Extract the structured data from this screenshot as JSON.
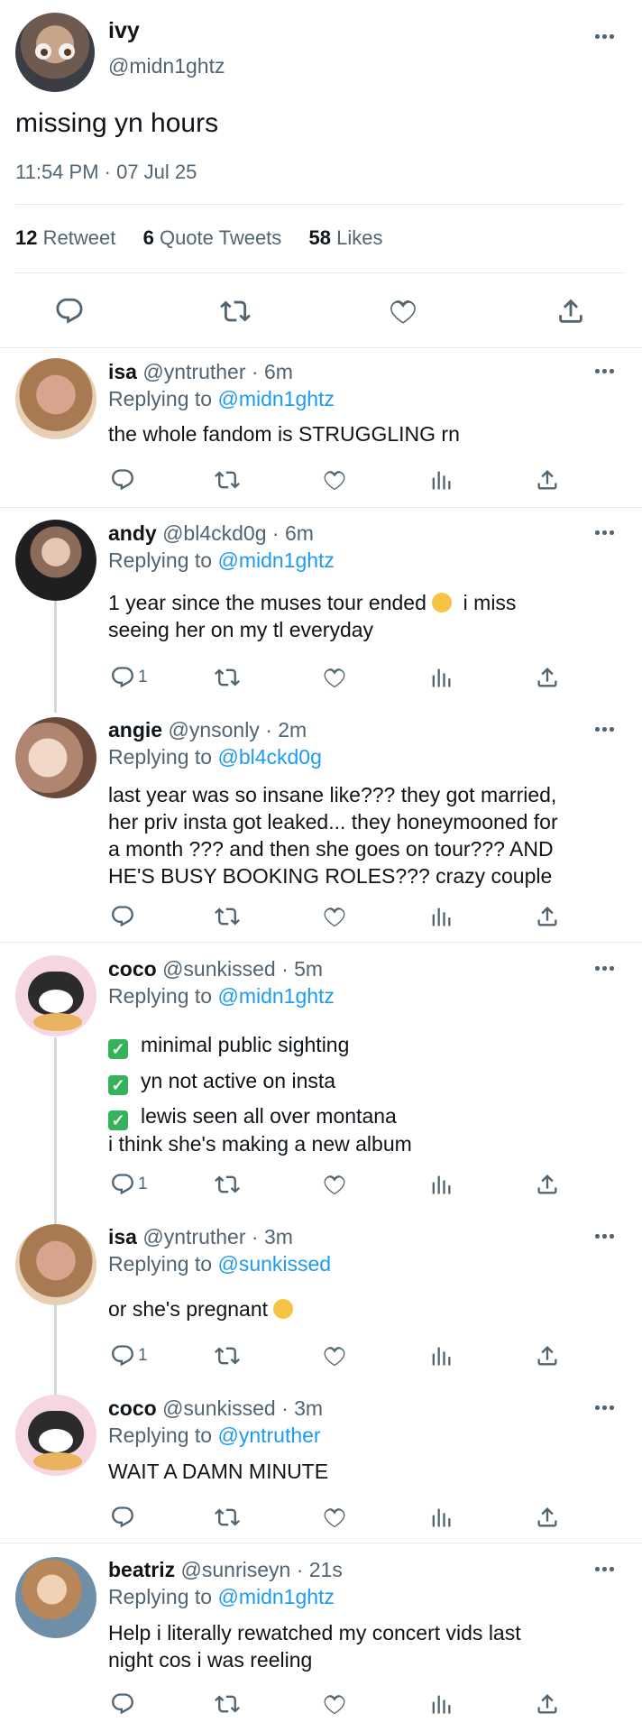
{
  "main_tweet": {
    "name": "ivy",
    "handle": "@midn1ghtz",
    "text": "missing yn hours",
    "timestamp": "11:54 PM · 07 Jul 25",
    "stats": {
      "retweets_count": "12",
      "retweets_label": "Retweet",
      "quotes_count": "6",
      "quotes_label": "Quote Tweets",
      "likes_count": "58",
      "likes_label": "Likes"
    }
  },
  "replies": [
    {
      "name": "isa",
      "handle": "@yntruther",
      "time": "· 6m",
      "replying_label": "Replying to",
      "replying_to": "@midn1ghtz",
      "lines": [
        "the whole fandom is STRUGGLING rn"
      ],
      "reply_count": ""
    },
    {
      "name": "andy",
      "handle": "@bl4ckd0g",
      "time": "· 6m",
      "replying_label": "Replying to",
      "replying_to": "@midn1ghtz",
      "lines": [
        "1 year since the muses tour ended",
        "i miss",
        "seeing her on my tl everyday"
      ],
      "reply_count": "1"
    },
    {
      "name": "angie",
      "handle": "@ynsonly",
      "time": "· 2m",
      "replying_label": "Replying to",
      "replying_to": "@bl4ckd0g",
      "lines": [
        "last year was so insane like??? they got married,",
        "her priv insta got leaked... they honeymooned for",
        "a month ??? and then she goes on tour??? AND",
        "HE'S BUSY BOOKING ROLES??? crazy couple"
      ],
      "reply_count": ""
    },
    {
      "name": "coco",
      "handle": "@sunkissed",
      "time": "· 5m",
      "replying_label": "Replying to",
      "replying_to": "@midn1ghtz",
      "lines": [
        "minimal public sighting",
        "yn not active on insta",
        "lewis seen all over montana",
        "i think she's making a new album"
      ],
      "reply_count": "1"
    },
    {
      "name": "isa",
      "handle": "@yntruther",
      "time": "· 3m",
      "replying_label": "Replying to",
      "replying_to": "@sunkissed",
      "lines": [
        "or she's pregnant"
      ],
      "reply_count": "1"
    },
    {
      "name": "coco",
      "handle": "@sunkissed",
      "time": "· 3m",
      "replying_label": "Replying to",
      "replying_to": "@yntruther",
      "lines": [
        "WAIT A DAMN MINUTE"
      ],
      "reply_count": ""
    },
    {
      "name": "beatriz",
      "handle": "@sunriseyn",
      "time": "· 21s",
      "replying_label": "Replying to",
      "replying_to": "@midn1ghtz",
      "lines": [
        "Help i literally rewatched my concert vids last",
        "night cos i was reeling"
      ],
      "reply_count": ""
    }
  ],
  "colors": {
    "accent": "#1d9bf0",
    "muted": "#536471",
    "check": "#34b35a"
  }
}
